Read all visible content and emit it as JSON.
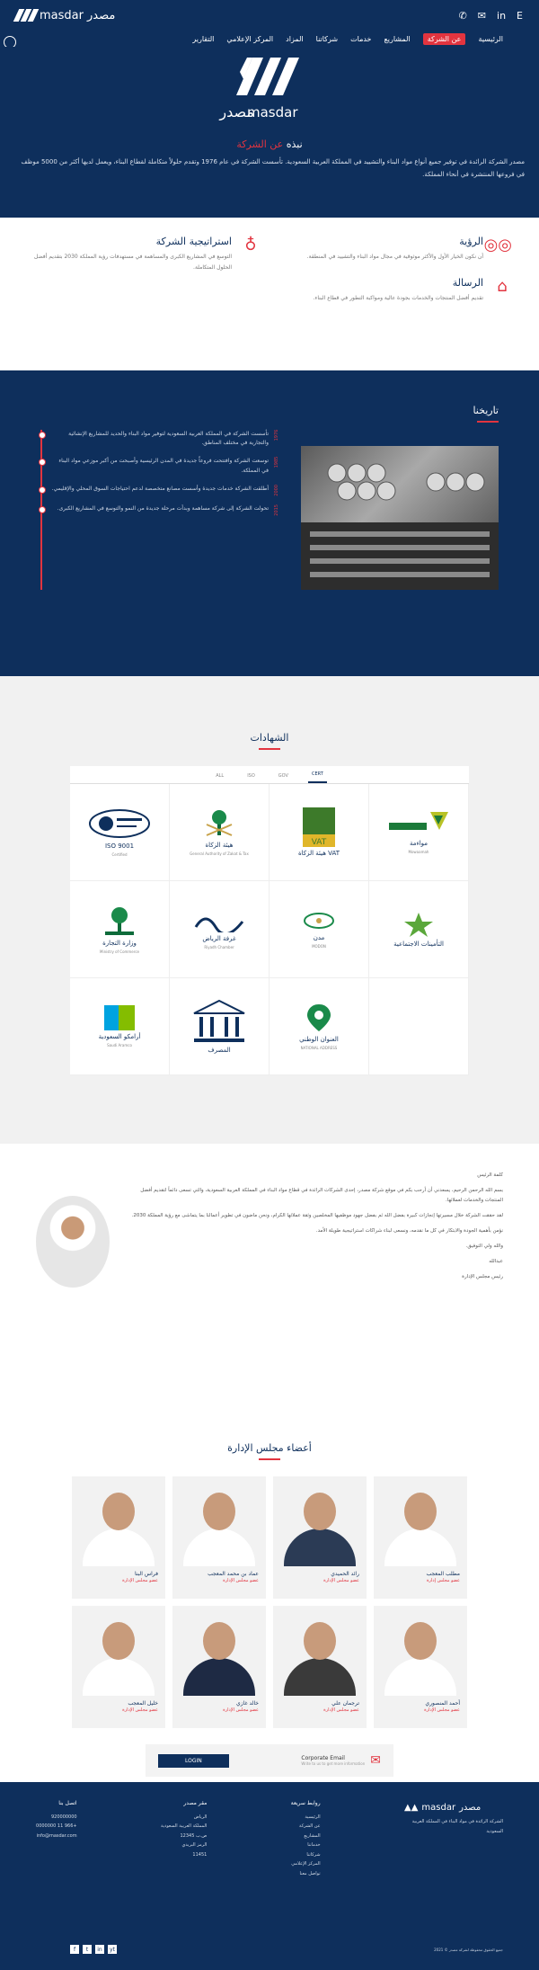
{
  "header": {
    "logo_text": "masdar",
    "logo_ar": "مصدر",
    "top_icons": [
      "phone-icon",
      "mail-icon",
      "linkedin-icon",
      "language-toggle"
    ],
    "lang_label": "E",
    "nav": [
      "الرئيسية",
      "عن الشركة",
      "المشاريع",
      "خدمات",
      "شركاتنا",
      "المزاد",
      "المركز الإعلامي",
      "التقارير"
    ]
  },
  "hero": {
    "title_prefix": "نبذه ",
    "title_red": "عن الشركة",
    "text": "مصدر الشركة الرائدة في توفير جميع أنواع مواد البناء والتشييد في المملكة العربية السعودية. تأسست الشركة في عام 1976 وتقدم حلولاً متكاملة لقطاع البناء، ويعمل لديها أكثر من 5000 موظف في فروعها المنتشرة في أنحاء المملكة."
  },
  "vision": {
    "items": [
      {
        "title": "الرؤية",
        "text": "أن نكون الخيار الأول والأكثر موثوقية في مجال مواد البناء والتشييد في المنطقة."
      },
      {
        "title": "استراتيجية الشركة",
        "text": "التوسع في المشاريع الكبرى والمساهمة في مستهدفات رؤية المملكة 2030 بتقديم أفضل الحلول المتكاملة."
      },
      {
        "title": "الرسالة",
        "text": "تقديم أفضل المنتجات والخدمات بجودة عالية ومواكبة التطور في قطاع البناء."
      }
    ]
  },
  "history": {
    "title": "تاريخنا",
    "items": [
      {
        "year": "1976",
        "text": "تأسست الشركة في المملكة العربية السعودية لتوفير مواد البناء والحديد للمشاريع الإنشائية والتجارية في مختلف المناطق."
      },
      {
        "year": "1985",
        "text": "توسعت الشركة وافتتحت فروعاً جديدة في المدن الرئيسية وأصبحت من أكبر موزعي مواد البناء في المملكة."
      },
      {
        "year": "2000",
        "text": "أطلقت الشركة خدمات جديدة وأسست مصانع متخصصة لدعم احتياجات السوق المحلي والإقليمي."
      },
      {
        "year": "2015",
        "text": "تحولت الشركة إلى شركة مساهمة وبدأت مرحلة جديدة من النمو والتوسع في المشاريع الكبرى."
      }
    ]
  },
  "certificates": {
    "title": "الشهادات",
    "tabs": [
      "ALL",
      "ISO",
      "GOV",
      "CERT"
    ],
    "logos": [
      {
        "name": "ISO 9001",
        "sub": "Certified",
        "icon": "iso-badge-icon"
      },
      {
        "name": "هيئة الزكاة",
        "sub": "General Authority of Zakat & Tax",
        "icon": "palm-swords-icon"
      },
      {
        "name": "هيئة الزكاة VAT",
        "sub": "",
        "icon": "vat-icon"
      },
      {
        "name": "مواءمة",
        "sub": "Mowaamah",
        "icon": "mowaamah-icon"
      },
      {
        "name": "وزارة التجارة",
        "sub": "Ministry of Commerce",
        "icon": "palm-icon"
      },
      {
        "name": "غرفة الرياض",
        "sub": "Riyadh Chamber",
        "icon": "chamber-icon"
      },
      {
        "name": "مدن",
        "sub": "MODON",
        "icon": "modon-icon"
      },
      {
        "name": "التأمينات الاجتماعية",
        "sub": "",
        "icon": "gosi-icon"
      },
      {
        "name": "أرامكو السعودية",
        "sub": "Saudi Aramco",
        "icon": "aramco-icon"
      },
      {
        "name": "المصرف",
        "sub": "",
        "icon": "bank-icon"
      },
      {
        "name": "العنوان الوطني",
        "sub": "NATIONAL ADDRESS",
        "icon": "location-pin-icon"
      },
      {
        "name": "",
        "sub": "",
        "icon": ""
      }
    ]
  },
  "ceo": {
    "greeting": "كلمة الرئيس",
    "paragraphs": [
      "بسم الله الرحمن الرحيم، يسعدني أن أرحب بكم في موقع شركة مصدر، إحدى الشركات الرائدة في قطاع مواد البناء في المملكة العربية السعودية، والتي تسعى دائماً لتقديم أفضل المنتجات والخدمات لعملائها.",
      "لقد حققت الشركة خلال مسيرتها إنجازات كبيرة بفضل الله ثم بفضل جهود موظفيها المخلصين وثقة عملائها الكرام، ونحن ماضون في تطوير أعمالنا بما يتماشى مع رؤية المملكة 2030.",
      "نؤمن بأهمية الجودة والابتكار في كل ما نقدمه، ونسعى لبناء شراكات استراتيجية طويلة الأمد.",
      "والله ولي التوفيق."
    ],
    "signature_name": "عبدالله",
    "signature_title": "رئيس مجلس الإدارة"
  },
  "board": {
    "title": "أعضاء مجلس الإدارة",
    "members": [
      {
        "name": "مطلب المعجب",
        "role": "عضو مجلس إدارة",
        "suit": "#ffffff"
      },
      {
        "name": "رائد الحميدي",
        "role": "عضو مجلس الإدارة",
        "suit": "#2b3b55"
      },
      {
        "name": "عماد بن محمد المعجب",
        "role": "عضو مجلس الإدارة",
        "suit": "#ffffff"
      },
      {
        "name": "فراس البنا",
        "role": "عضو مجلس الإدارة",
        "suit": "#ffffff"
      },
      {
        "name": "أحمد المنصوري",
        "role": "عضو مجلس الإدارة",
        "suit": "#ffffff"
      },
      {
        "name": "ترجمان علي",
        "role": "عضو مجلس الإدارة",
        "suit": "#3a3a3a"
      },
      {
        "name": "خالد غازي",
        "role": "عضو مجلس الإدارة",
        "suit": "#1e2a44"
      },
      {
        "name": "خليل المعجب",
        "role": "عضو مجلس الإدارة",
        "suit": "#ffffff"
      }
    ]
  },
  "banner": {
    "heading": "Corporate Email",
    "sub": "Write to us to get more information",
    "button": "LOGIN"
  },
  "footer": {
    "col1": {
      "title": "روابط سريعة",
      "links": [
        "الرئيسية",
        "عن الشركة",
        "المشاريع",
        "خدماتنا",
        "شركاتنا",
        "المركز الإعلامي",
        "تواصل معنا"
      ]
    },
    "col2": {
      "title": "مقر مصدر",
      "lines": [
        "الرياض",
        "المملكة العربية السعودية",
        "ص.ب 12345",
        "الرمز البريدي",
        "11451"
      ]
    },
    "col3": {
      "title": "اتصل بنا",
      "lines": [
        "920000000",
        "+966 11 0000000",
        "info@masdar.com"
      ]
    },
    "brand_text": "الشركة الرائدة في مواد البناء في المملكة العربية السعودية",
    "copyright": "جميع الحقوق محفوظة لشركة مصدر © 2021",
    "social": [
      "f",
      "t",
      "in",
      "yt"
    ]
  }
}
